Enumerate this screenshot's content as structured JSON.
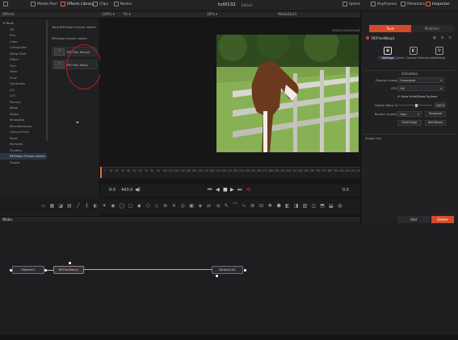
{
  "topbar": {
    "media_pool": "Media Pool",
    "effects_library": "Effects Library",
    "clips": "Clips",
    "nodes": "Nodes",
    "title": "tut0132",
    "edited": "Edited",
    "spline": "Spline",
    "keyframes": "Keyframes",
    "metadata": "Metadata",
    "inspector": "Inspector"
  },
  "subbar": {
    "effects": "Effects",
    "zoom": "100% ▾",
    "fit": "Fit ▾",
    "viewer_zoom": "30% ▾",
    "media_out": "MediaOut1",
    "inspector": "Inspector"
  },
  "tools": {
    "items": [
      {
        "label": "▾ Tools",
        "head": true
      },
      {
        "label": "3D"
      },
      {
        "label": "Blur"
      },
      {
        "label": "Color"
      },
      {
        "label": "Composite"
      },
      {
        "label": "Deep Pixel"
      },
      {
        "label": "Effect"
      },
      {
        "label": "Film"
      },
      {
        "label": "Filter"
      },
      {
        "label": "Flow"
      },
      {
        "label": "Generator"
      },
      {
        "label": "I/O"
      },
      {
        "label": "LUT"
      },
      {
        "label": "Macros"
      },
      {
        "label": "Mask"
      },
      {
        "label": "Matte"
      },
      {
        "label": "Metadata"
      },
      {
        "label": "Miscellaneous"
      },
      {
        "label": "Optical Flow"
      },
      {
        "label": "Paint"
      },
      {
        "label": "Particles"
      },
      {
        "label": "Position"
      },
      {
        "label": "REVision Fusion native",
        "sel": true
      },
      {
        "label": "Shape"
      }
    ]
  },
  "revision": {
    "path": "Tools\\REVision Fusion native",
    "header": "REVision Fusion native",
    "item1": "RE:Flex Morph",
    "item2": "RE:Flex Warp"
  },
  "viewer": {
    "resolution": "3840x2160xFloat32"
  },
  "timeline": {
    "ticks": [
      "0",
      "10",
      "20",
      "30",
      "40",
      "50",
      "60",
      "70",
      "80",
      "90",
      "100",
      "110",
      "120",
      "130",
      "140",
      "150",
      "160",
      "170",
      "180",
      "190",
      "200",
      "210",
      "220",
      "230",
      "240",
      "250",
      "260",
      "270",
      "280",
      "290",
      "300",
      "310",
      "320",
      "330",
      "340",
      "350",
      "360",
      "370",
      "380",
      "390",
      "400",
      "410",
      "420",
      "430"
    ],
    "start": "0.0",
    "end": "443.0",
    "current": "0.0"
  },
  "inspector": {
    "tab_tools": "Tools",
    "tab_modifiers": "Modifiers",
    "node_name": "REFlexWarp1",
    "sub_tabs": [
      "Settings",
      "Inter. Control Preferences",
      "Settings"
    ],
    "section": "Activation",
    "display_image_label": "Display Image",
    "display_image_value": "Unwarped",
    "gpu_label": "GPU",
    "gpu_value": "ON",
    "auto_hide": "Auto Hide/Show Splines",
    "global_warp_label": "Global Warp %",
    "global_warp_value": "100.0",
    "render_quality_label": "Render Quality",
    "render_quality_value": "High",
    "temporal": "Temporal",
    "hold_edge": "Hold Edge",
    "add_room": "Add Room",
    "shape_list": "Shape List",
    "add": "Add",
    "delete": "Delete"
  },
  "nodes": {
    "title": "Nodes",
    "media_in": "MediaIn1",
    "warp": "REFlexWarp1",
    "media_out": "MediaOut1"
  },
  "colors": {
    "accent": "#d24b2b",
    "selection": "#2f3445",
    "highlight_circle": "#c21c24"
  }
}
